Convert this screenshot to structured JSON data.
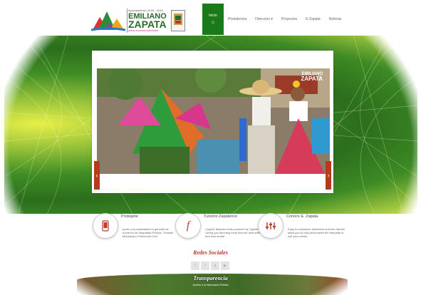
{
  "brand": {
    "period": "Ayuntamiento 2018 - 2021",
    "name_line1": "EMILIANO",
    "name_line2": "ZAPATA",
    "motto": "juntos sumando soluciones"
  },
  "nav": {
    "items": [
      {
        "label": "Inicio",
        "active": true
      },
      {
        "label": "Presidencia"
      },
      {
        "label": "Direccion ▾"
      },
      {
        "label": "Proyectos"
      },
      {
        "label": "E-Zapata"
      },
      {
        "label": "Noticias"
      }
    ],
    "home_icon": "home-icon"
  },
  "slider": {
    "overlay_logo_line1": "EMILIANO",
    "overlay_logo_line2": "ZAPATA",
    "prev_label": "‹",
    "next_label": "›"
  },
  "features": [
    {
      "icon": "mobile-phone-icon",
      "title": "Protegete",
      "desc": "poner a la ciudadania en general los números de Seguridad Publica, Transito Municipal y Protección Civil."
    },
    {
      "icon": "font-f-icon",
      "title": "Turismo Zapatence",
      "desc": "Cogent' features fonts powered by Typekit. Giving you stunning fonts that are web-safe and look smart!"
    },
    {
      "icon": "sliders-icon",
      "title": "Conoce E. Zapata",
      "desc": "Easy to customize slideshow and text frames allow you to fully personalize the template to suit your needs."
    }
  ],
  "social": {
    "title": "Redes Sociales",
    "icons": [
      "facebook-icon",
      "twitter-icon",
      "google-plus-icon",
      "youtube-icon"
    ]
  },
  "footer": {
    "title": "Transparencia",
    "subtitle": "Acceso a la Información Pública"
  },
  "colors": {
    "accent": "#1a7a1a",
    "brand_green": "#2e6b2d",
    "social_title": "#b8352a"
  }
}
